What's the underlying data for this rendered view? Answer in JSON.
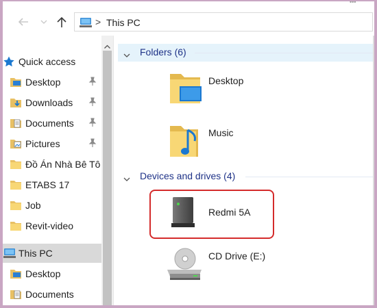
{
  "window": {
    "top_right_glyph": "•••"
  },
  "address_bar": {
    "crumbs": [
      "This PC"
    ],
    "separator": ">"
  },
  "nav_pane": {
    "items": [
      {
        "label": "Quick access",
        "icon": "star-icon",
        "header": true,
        "pinned": false
      },
      {
        "label": "Desktop",
        "icon": "desktop-folder-icon",
        "pinned": true
      },
      {
        "label": "Downloads",
        "icon": "downloads-folder-icon",
        "pinned": true
      },
      {
        "label": "Documents",
        "icon": "documents-folder-icon",
        "pinned": true
      },
      {
        "label": "Pictures",
        "icon": "pictures-folder-icon",
        "pinned": true
      },
      {
        "label": "Đồ Án Nhà Bê Tô",
        "icon": "folder-icon",
        "pinned": false
      },
      {
        "label": "ETABS 17",
        "icon": "folder-icon",
        "pinned": false
      },
      {
        "label": "Job",
        "icon": "folder-icon",
        "pinned": false
      },
      {
        "label": "Revit-video",
        "icon": "folder-icon",
        "pinned": false
      },
      {
        "label": "This PC",
        "icon": "this-pc-icon",
        "header": true,
        "selected": true
      },
      {
        "label": "Desktop",
        "icon": "desktop-folder-icon",
        "pinned": false
      },
      {
        "label": "Documents",
        "icon": "documents-folder-icon",
        "pinned": false
      }
    ]
  },
  "content": {
    "folders_group": {
      "title": "Folders (6)"
    },
    "folders": [
      {
        "name": "Desktop",
        "icon": "desktop-folder-large-icon"
      },
      {
        "name": "Music",
        "icon": "music-folder-large-icon"
      }
    ],
    "devices_group": {
      "title": "Devices and drives (4)"
    },
    "devices": [
      {
        "name": "Redmi 5A",
        "icon": "phone-device-icon"
      },
      {
        "name": "CD Drive (E:)",
        "icon": "cd-drive-icon"
      }
    ]
  },
  "colors": {
    "group_title": "#1e3287",
    "selection": "#d9d9d9",
    "group_highlight": "#e5f3fb",
    "annotation_box": "#d42a2a",
    "folder_yellow": "#f8d775"
  }
}
